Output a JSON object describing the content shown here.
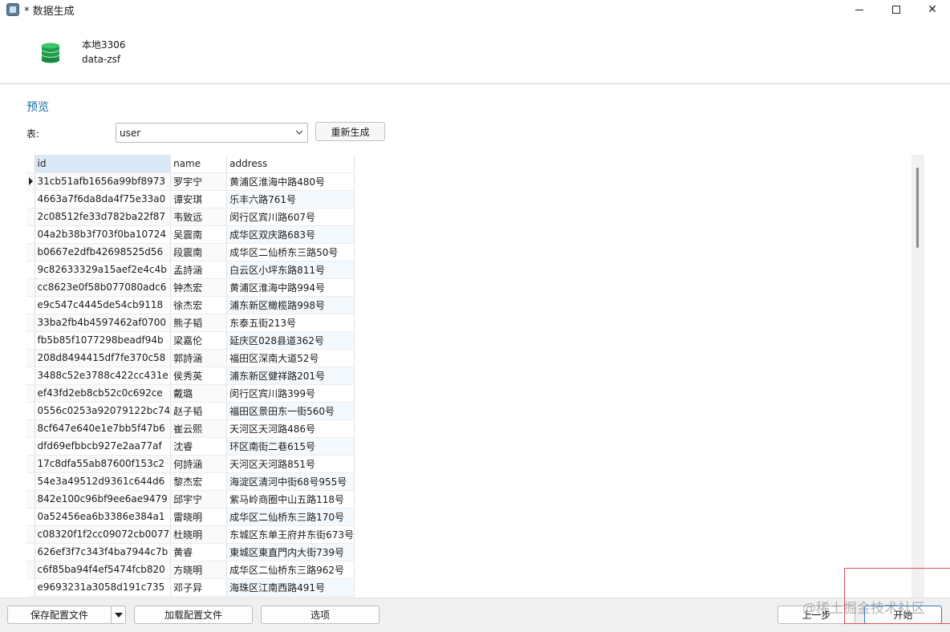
{
  "window": {
    "title": "* 数据生成"
  },
  "header": {
    "connection_name": "本地3306",
    "database_name": "data-zsf"
  },
  "preview": {
    "title": "预览",
    "table_label": "表:",
    "table_selected": "user",
    "regenerate_label": "重新生成"
  },
  "grid": {
    "columns": [
      "id",
      "name",
      "address"
    ],
    "rows": [
      [
        "31cb51afb1656a99bf8973",
        "罗宇宁",
        "黄浦区淮海中路480号"
      ],
      [
        "4663a7f6da8da4f75e33a0",
        "谭安琪",
        "乐丰六路761号"
      ],
      [
        "2c08512fe33d782ba22f87",
        "韦致远",
        "闵行区宾川路607号"
      ],
      [
        "04a2b38b3f703f0ba10724",
        "吴震南",
        "成华区双庆路683号"
      ],
      [
        "b0667e2dfb42698525d56",
        "段震南",
        "成华区二仙桥东三路50号"
      ],
      [
        "9c82633329a15aef2e4c4b",
        "孟詩涵",
        "白云区小坪东路811号"
      ],
      [
        "cc8623e0f58b077080adc6",
        "钟杰宏",
        "黄浦区淮海中路994号"
      ],
      [
        "e9c547c4445de54cb9118",
        "徐杰宏",
        "浦东新区橄榄路998号"
      ],
      [
        "33ba2fb4b4597462af0700",
        "熊子韬",
        "东泰五街213号"
      ],
      [
        "fb5b85f1077298beadf94b",
        "梁嘉伦",
        "延庆区028县道362号"
      ],
      [
        "208d8494415df7fe370c58",
        "郭詩涵",
        "福田区深南大道52号"
      ],
      [
        "3488c52e3788c422cc431e",
        "侯秀英",
        "浦东新区健祥路201号"
      ],
      [
        "ef43fd2eb8cb52c0c692ce",
        "戴璐",
        "闵行区宾川路399号"
      ],
      [
        "0556c0253a92079122bc74",
        "赵子韬",
        "福田区景田东一街560号"
      ],
      [
        "8cf647e640e1e7bb5f47b6",
        "崔云熙",
        "天河区天河路486号"
      ],
      [
        "dfd69efbbcb927e2aa77af",
        "沈睿",
        "环区南街二巷615号"
      ],
      [
        "17c8dfa55ab87600f153c2",
        "何詩涵",
        "天河区天河路851号"
      ],
      [
        "54e3a49512d9361c644d6",
        "黎杰宏",
        "海淀区清河中街68号955号"
      ],
      [
        "842e100c96bf9ee6ae9479",
        "邱宇宁",
        "紫马岭商圈中山五路118号"
      ],
      [
        "0a52456ea6b3386e384a1",
        "雷晓明",
        "成华区二仙桥东三路170号"
      ],
      [
        "c08320f1f2cc09072cb0077",
        "杜晓明",
        "东城区东单王府井东街673号"
      ],
      [
        "626ef3f7c343f4ba7944c7b",
        "黄睿",
        "東城区東直門内大街739号"
      ],
      [
        "c6f85ba94f4ef5474fcb820",
        "方晓明",
        "成华区二仙桥东三路962号"
      ],
      [
        "e9693231a3058d191c735",
        "邓子异",
        "海珠区江南西路491号"
      ]
    ]
  },
  "footer": {
    "save_config_label": "保存配置文件",
    "load_config_label": "加载配置文件",
    "options_label": "选项",
    "prev_label": "上一步",
    "start_label": "开始"
  },
  "watermark": "@稀土掘金技术社区",
  "icons": {
    "app": "app-icon",
    "connection": "database-icon",
    "dropdown": "chevron-down-icon",
    "split": "triangle-down-icon"
  },
  "colors": {
    "accent": "#1b6fa8",
    "db_icon": "#1e9e4a",
    "selected_header": "#dbe9f6",
    "primary_border": "#2a7bd0"
  }
}
